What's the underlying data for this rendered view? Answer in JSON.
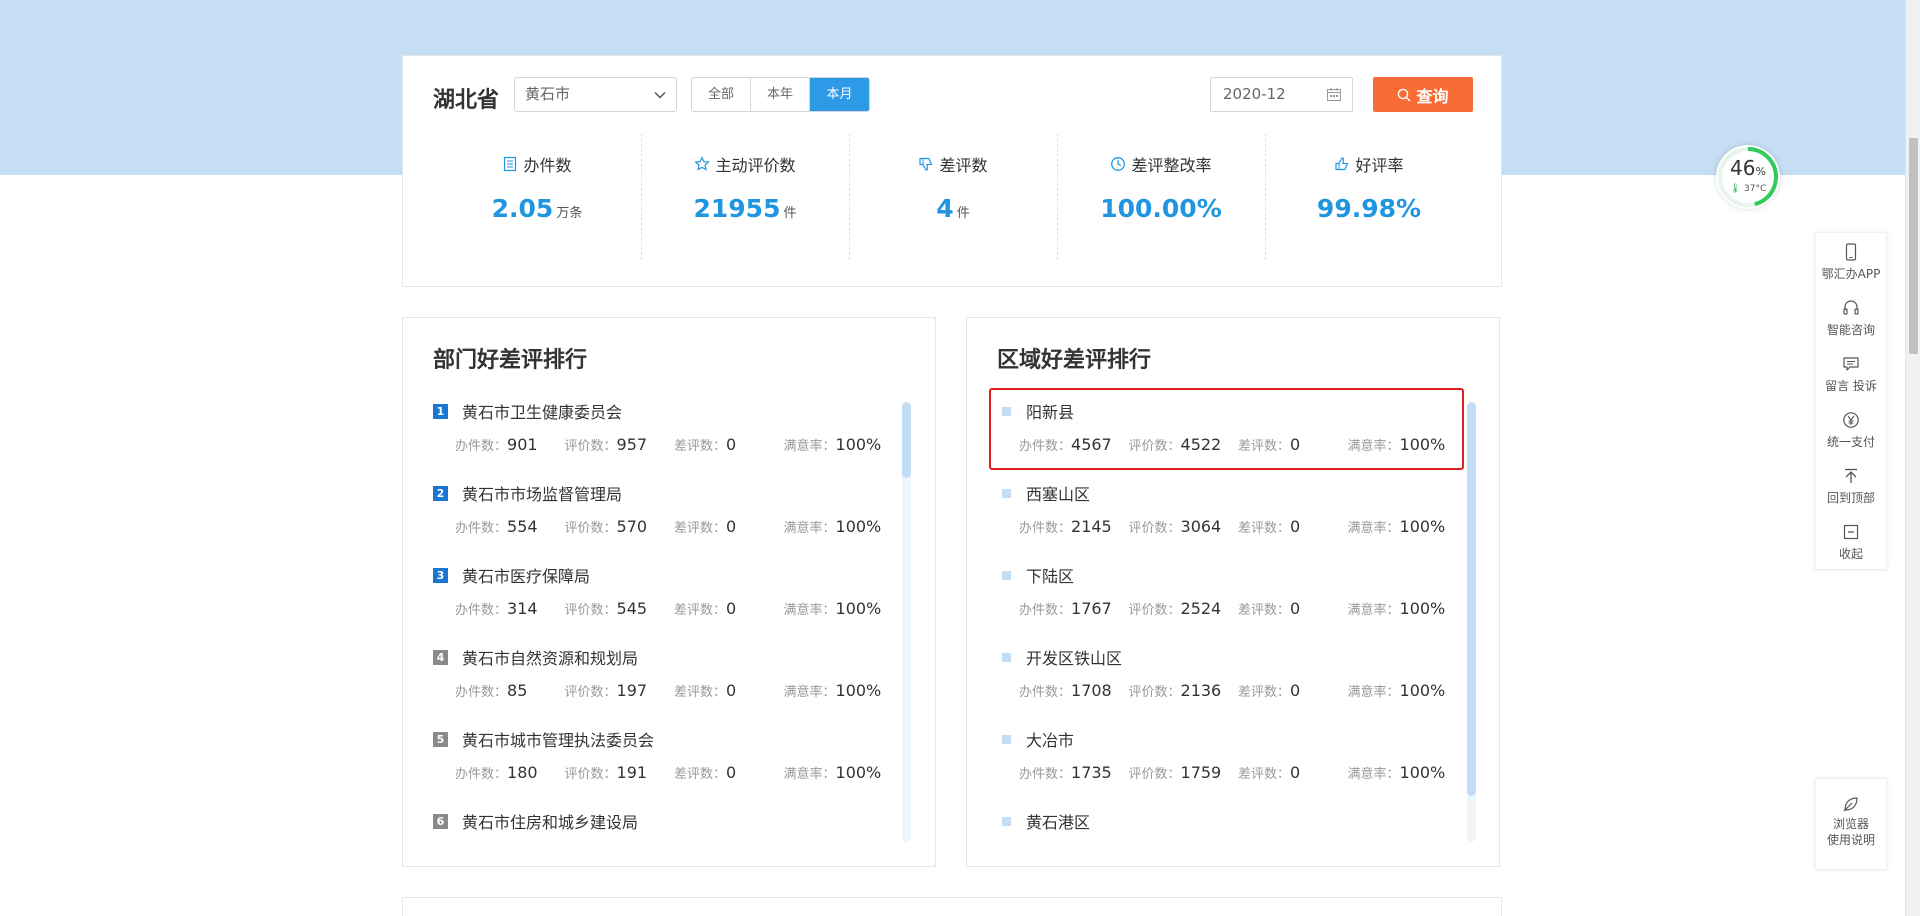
{
  "filter": {
    "province": "湖北省",
    "city_selected": "黄石市",
    "ranges": [
      {
        "label": "全部",
        "active": false
      },
      {
        "label": "本年",
        "active": false
      },
      {
        "label": "本月",
        "active": true
      }
    ],
    "date_value": "2020-12",
    "query_label": "查询"
  },
  "stats": [
    {
      "label": "办件数",
      "value": "2.05",
      "unit": "万条",
      "icon": "document-icon"
    },
    {
      "label": "主动评价数",
      "value": "21955",
      "unit": "件",
      "icon": "star-icon"
    },
    {
      "label": "差评数",
      "value": "4",
      "unit": "件",
      "icon": "thumbs-down-icon"
    },
    {
      "label": "差评整改率",
      "value": "100.00%",
      "unit": "",
      "icon": "clock-icon"
    },
    {
      "label": "好评率",
      "value": "99.98%",
      "unit": "",
      "icon": "thumbs-up-icon"
    }
  ],
  "metric_labels": {
    "handled": "办件数：",
    "rated": "评价数：",
    "bad": "差评数：",
    "satisfaction": "满意率："
  },
  "dept_panel": {
    "title": "部门好差评排行",
    "items": [
      {
        "rank": "1",
        "name": "黄石市卫生健康委员会",
        "handled": "901",
        "rated": "957",
        "bad": "0",
        "satisfaction": "100%"
      },
      {
        "rank": "2",
        "name": "黄石市市场监督管理局",
        "handled": "554",
        "rated": "570",
        "bad": "0",
        "satisfaction": "100%"
      },
      {
        "rank": "3",
        "name": "黄石市医疗保障局",
        "handled": "314",
        "rated": "545",
        "bad": "0",
        "satisfaction": "100%"
      },
      {
        "rank": "4",
        "name": "黄石市自然资源和规划局",
        "handled": "85",
        "rated": "197",
        "bad": "0",
        "satisfaction": "100%"
      },
      {
        "rank": "5",
        "name": "黄石市城市管理执法委员会",
        "handled": "180",
        "rated": "191",
        "bad": "0",
        "satisfaction": "100%"
      },
      {
        "rank": "6",
        "name": "黄石市住房和城乡建设局",
        "handled": "",
        "rated": "",
        "bad": "",
        "satisfaction": ""
      }
    ]
  },
  "region_panel": {
    "title": "区域好差评排行",
    "items": [
      {
        "name": "阳新县",
        "handled": "4567",
        "rated": "4522",
        "bad": "0",
        "satisfaction": "100%"
      },
      {
        "name": "西塞山区",
        "handled": "2145",
        "rated": "3064",
        "bad": "0",
        "satisfaction": "100%"
      },
      {
        "name": "下陆区",
        "handled": "1767",
        "rated": "2524",
        "bad": "0",
        "satisfaction": "100%"
      },
      {
        "name": "开发区铁山区",
        "handled": "1708",
        "rated": "2136",
        "bad": "0",
        "satisfaction": "100%"
      },
      {
        "name": "大冶市",
        "handled": "1735",
        "rated": "1759",
        "bad": "0",
        "satisfaction": "100%"
      },
      {
        "name": "黄石港区",
        "handled": "",
        "rated": "",
        "bad": "",
        "satisfaction": ""
      }
    ]
  },
  "gauge": {
    "percent": "46",
    "percent_sign": "%",
    "temperature": "37°C",
    "fraction": 0.46
  },
  "side_tools": [
    {
      "label": "鄂汇办APP",
      "icon": "phone-icon"
    },
    {
      "label": "智能咨询",
      "icon": "headset-icon"
    },
    {
      "label": "留言 投诉",
      "icon": "message-icon"
    },
    {
      "label": "统一支付",
      "icon": "yuan-icon"
    },
    {
      "label": "回到顶部",
      "icon": "back-to-top-icon"
    },
    {
      "label": "收起",
      "icon": "collapse-icon"
    }
  ],
  "browser_help": {
    "line1": "浏览器",
    "line2": "使用说明",
    "icon": "leaf-icon"
  },
  "colors": {
    "accent": "#2196e0",
    "query": "#f86c36",
    "highlight": "#e21f1f",
    "band": "#c5def3"
  }
}
